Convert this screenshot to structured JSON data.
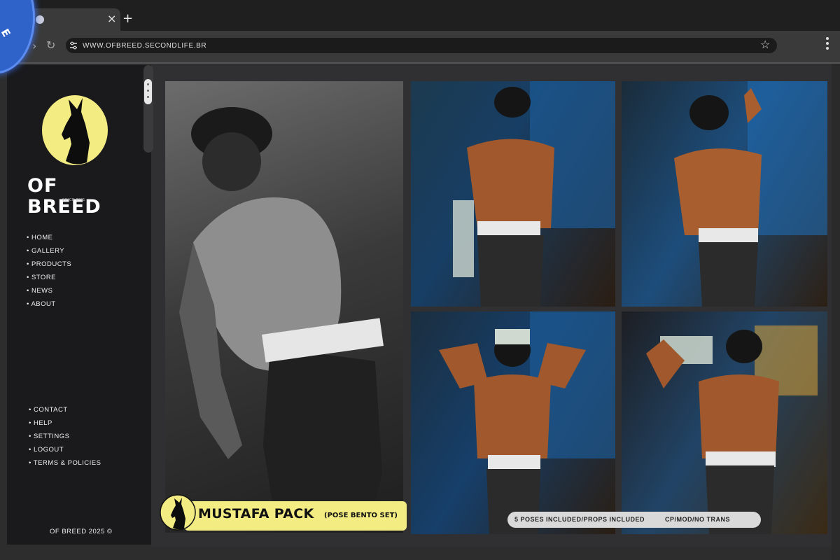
{
  "browser": {
    "tab_close": "×",
    "tab_new": "+",
    "url": "WWW.OFBREED.SECONDLIFE.BR"
  },
  "badge": {
    "letter": "E"
  },
  "sidebar": {
    "brand": "OF BREED",
    "since": "SINCE 2021",
    "nav_items": [
      "• HOME",
      "• GALLERY",
      "• PRODUCTS",
      "• STORE",
      "• NEWS",
      "• ABOUT"
    ],
    "secondary_items": [
      "• CONTACT",
      "• HELP",
      "• SETTINGS",
      "• LOGOUT",
      "• TERMS & POLICIES"
    ],
    "copyright": "OF BREED 2025 ©"
  },
  "product": {
    "title": "MUSTAFA PACK",
    "subtitle": "(POSE BENTO SET)",
    "logo_text": "OF BREED",
    "poses_info": "5 POSES INCLUDED/PROPS INCLUDED",
    "permissions": "CP/MOD/NO TRANS"
  },
  "colors": {
    "accent_yellow": "#f3ec83",
    "sidebar_bg": "#1a1a1c",
    "badge_blue": "#2f63c9"
  }
}
